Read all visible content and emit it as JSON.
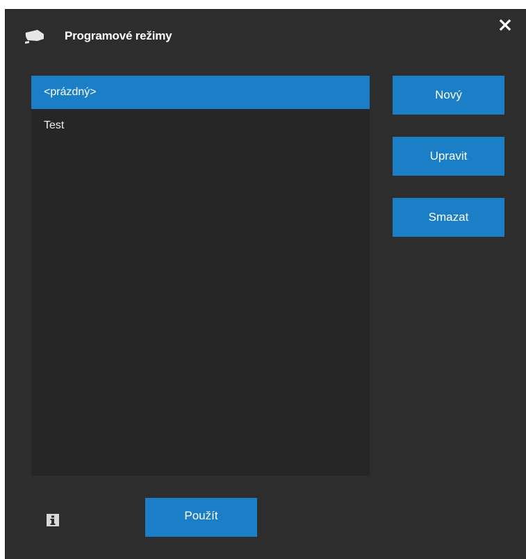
{
  "dialog": {
    "title": "Programové režimy",
    "title_icon": "camera-icon",
    "close_icon": "close-icon"
  },
  "list": {
    "items": [
      {
        "label": "<prázdný>",
        "selected": true
      },
      {
        "label": "Test",
        "selected": false
      }
    ]
  },
  "buttons": {
    "new_label": "Nový",
    "edit_label": "Upravit",
    "delete_label": "Smazat",
    "apply_label": "Použít"
  },
  "footer": {
    "info_icon": "info-icon"
  },
  "colors": {
    "background": "#2d2d2d",
    "list_background": "#262626",
    "accent": "#1a7fc6",
    "text": "#ffffff"
  }
}
